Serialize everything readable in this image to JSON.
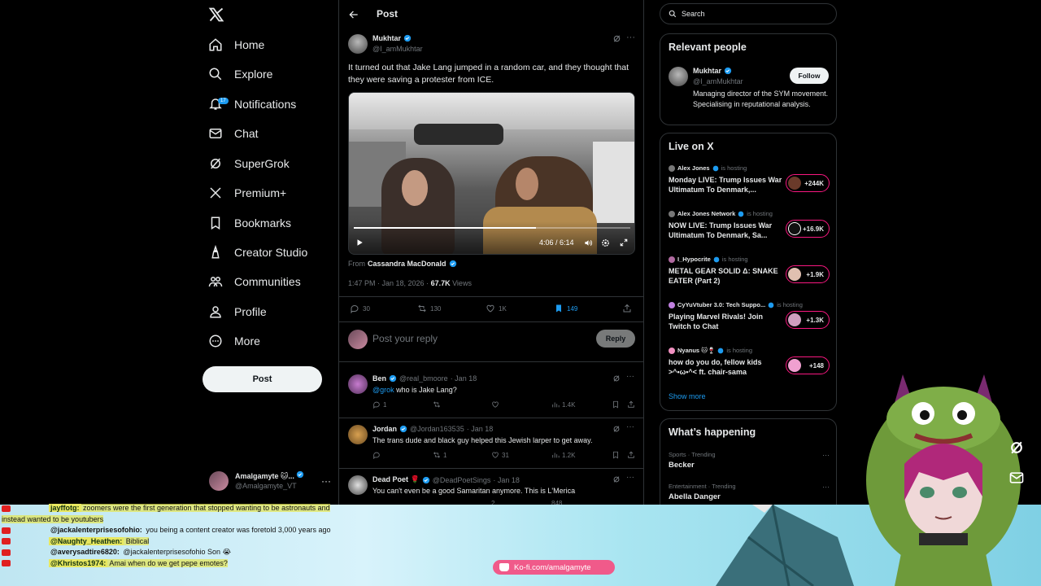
{
  "nav": {
    "items": [
      {
        "label": "Home",
        "icon": "home-icon"
      },
      {
        "label": "Explore",
        "icon": "search-icon"
      },
      {
        "label": "Notifications",
        "icon": "bell-icon"
      },
      {
        "label": "Chat",
        "icon": "mail-icon"
      },
      {
        "label": "SuperGrok",
        "icon": "grok-icon"
      },
      {
        "label": "Premium+",
        "icon": "x-icon"
      },
      {
        "label": "Bookmarks",
        "icon": "bookmark-icon"
      },
      {
        "label": "Creator Studio",
        "icon": "creator-icon"
      },
      {
        "label": "Communities",
        "icon": "communities-icon"
      },
      {
        "label": "Profile",
        "icon": "profile-icon"
      },
      {
        "label": "More",
        "icon": "more-icon"
      }
    ],
    "notification_count": "17",
    "post_button": "Post",
    "account": {
      "name": "Amalgamyte 🐱...",
      "handle": "@Amalgamyte_VT",
      "more": "···"
    }
  },
  "post": {
    "header_title": "Post",
    "author": {
      "name": "Mukhtar",
      "handle": "@I_amMukhtar"
    },
    "more": "···",
    "text": "It turned out that Jake Lang jumped in a random car, and they thought that they were saving a protester from ICE.",
    "video": {
      "time": "4:06 / 6:14",
      "progress": 0.66
    },
    "from_label": "From",
    "from_name": "Cassandra MacDonald",
    "timestamp": "1:47 PM · Jan 18, 2026 · ",
    "views_count": "67.7K",
    "views_label": " Views",
    "stats": {
      "replies": "30",
      "reposts": "130",
      "likes": "1K",
      "bookmarks": "149"
    }
  },
  "reply_box": {
    "placeholder": "Post your reply",
    "button": "Reply"
  },
  "replies": [
    {
      "name": "Ben",
      "handle": "@real_bmoore",
      "date": "· Jan 18",
      "mention": "@grok",
      "text": " who is Jake Lang?",
      "comments": "1",
      "reposts": "",
      "likes": "",
      "views": "1.4K"
    },
    {
      "name": "Jordan",
      "handle": "@Jordan163535",
      "date": "· Jan 18",
      "mention": "",
      "text": "The trans dude and black guy helped this Jewish larper to get away.",
      "comments": "",
      "reposts": "1",
      "likes": "31",
      "views": "1.2K"
    },
    {
      "name": "Dead Poet 🌹",
      "handle": "@DeadPoetSings",
      "date": "· Jan 18",
      "mention": "",
      "text": "You can't even be a good Samaritan anymore. This is L'Merica",
      "comments": "",
      "reposts": "",
      "likes": "2",
      "views": "848"
    }
  ],
  "search": {
    "placeholder": "Search"
  },
  "relevant_people": {
    "title": "Relevant people",
    "name": "Mukhtar",
    "handle": "@I_amMukhtar",
    "follow": "Follow",
    "bio": "Managing director of the SYM movement. Specialising in reputational analysis."
  },
  "live": {
    "title": "Live on X",
    "hosting_label": "is hosting",
    "items": [
      {
        "host": "Alex Jones",
        "title": "Monday LIVE: Trump Issues War Ultimatum To Denmark,...",
        "count": "+244K"
      },
      {
        "host": "Alex Jones Network",
        "title": "NOW LIVE: Trump Issues War Ultimatum To Denmark, Sa...",
        "count": "+16.9K"
      },
      {
        "host": "I_Hypocrite",
        "title": "METAL GEAR SOLID Δ: SNAKE EATER (Part 2)",
        "count": "+1.9K"
      },
      {
        "host": "CyYuVtuber 3.0: Tech Suppo...",
        "title": "Playing Marvel Rivals! Join Twitch to Chat",
        "count": "+1.3K"
      },
      {
        "host": "Nyanus 🐱🍷",
        "title": "how do you do, fellow kids >^•ω•^< ft. chair-sama",
        "count": "+148"
      }
    ],
    "show_more": "Show more"
  },
  "happening": {
    "title": "What’s happening",
    "trends": [
      {
        "category": "Sports · Trending",
        "name": "Becker"
      },
      {
        "category": "Entertainment · Trending",
        "name": "Abella Danger"
      }
    ]
  },
  "chat": [
    {
      "user": "jayffotg:",
      "msg": " zoomers were the first generation that stopped wanting to be astronauts and instead wanted to be youtubers",
      "hl": true
    },
    {
      "user": "@jackalenterprisesofohio:",
      "msg": " you being a content creator was foretold 3,000 years ago",
      "hl": false
    },
    {
      "user": "@Naughty_Heathen:",
      "msg": " Biblical",
      "hl": true
    },
    {
      "user": "@averysadtire6820:",
      "msg": " @jackalenterprisesofohio Son 😭",
      "hl": false
    },
    {
      "user": "@Khristos1974:",
      "msg": " Amai when do we get pepe emotes?",
      "hl": true
    }
  ],
  "kofi": {
    "label": "Ko-fi.com/amalgamyte"
  },
  "colors": {
    "accent": "#1d9bf0",
    "live_ring": "#f91880",
    "kofi": "#f05a8a"
  }
}
